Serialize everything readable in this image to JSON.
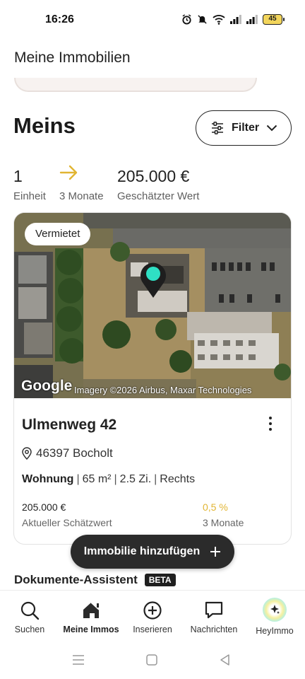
{
  "status_bar": {
    "time": "16:26",
    "battery": "45",
    "icons": [
      "alarm-icon",
      "mute-icon",
      "wifi-icon",
      "signal-icon",
      "signal-icon",
      "battery-icon"
    ]
  },
  "header": {
    "title": "Meine Immobilien"
  },
  "section": {
    "title": "Meins",
    "filter_label": "Filter"
  },
  "stats": {
    "units_value": "1",
    "units_label": "Einheit",
    "trend_label": "3 Monate",
    "estimated_value": "205.000 €",
    "estimated_label": "Geschätzter Wert"
  },
  "property": {
    "badge": "Vermietet",
    "map_logo": "Google",
    "map_attribution": "Imagery ©2026 Airbus, Maxar Technologies",
    "street": "Ulmenweg 42",
    "location": "46397 Bocholt",
    "type": "Wohnung",
    "size": "65 m²",
    "rooms": "2.5 Zi.",
    "position": "Rechts",
    "separator": "|",
    "value": "205.000 €",
    "value_label": "Aktueller Schätzwert",
    "change": "0,5 %",
    "change_period": "3 Monate"
  },
  "fab": {
    "label": "Immobilie hinzufügen"
  },
  "assistant": {
    "title": "Dokumente-Assistent",
    "badge": "BETA"
  },
  "bottom_nav": {
    "items": [
      {
        "label": "Suchen",
        "icon": "search-icon"
      },
      {
        "label": "Meine Immos",
        "icon": "home-icon"
      },
      {
        "label": "Inserieren",
        "icon": "plus-circle-icon"
      },
      {
        "label": "Nachrichten",
        "icon": "chat-icon"
      },
      {
        "label": "HeyImmo",
        "icon": "sparkle-icon"
      }
    ],
    "active_index": 1
  },
  "colors": {
    "accent_yellow": "#e1b533",
    "pin_teal": "#2fe0c4",
    "dark": "#2b2b2b"
  }
}
